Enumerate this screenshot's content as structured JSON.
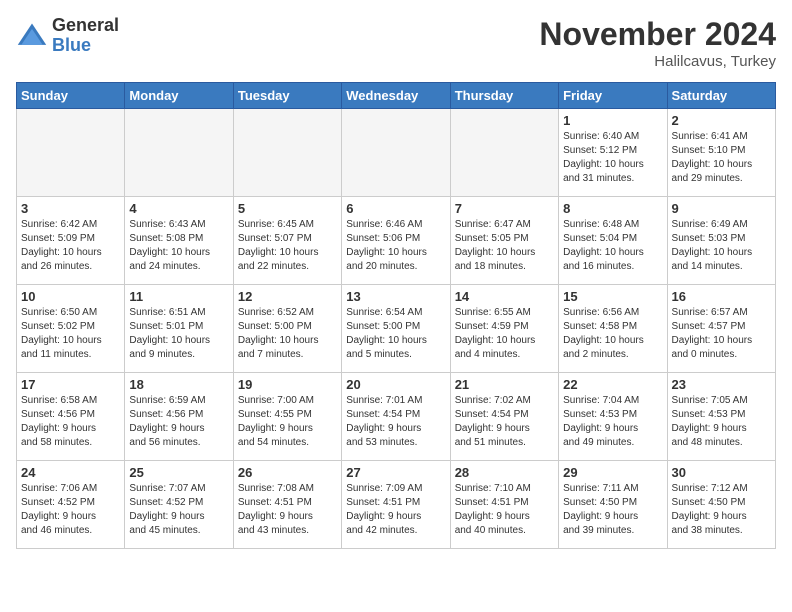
{
  "header": {
    "logo_general": "General",
    "logo_blue": "Blue",
    "month_title": "November 2024",
    "location": "Halilcavus, Turkey"
  },
  "weekdays": [
    "Sunday",
    "Monday",
    "Tuesday",
    "Wednesday",
    "Thursday",
    "Friday",
    "Saturday"
  ],
  "weeks": [
    [
      {
        "day": "",
        "info": ""
      },
      {
        "day": "",
        "info": ""
      },
      {
        "day": "",
        "info": ""
      },
      {
        "day": "",
        "info": ""
      },
      {
        "day": "",
        "info": ""
      },
      {
        "day": "1",
        "info": "Sunrise: 6:40 AM\nSunset: 5:12 PM\nDaylight: 10 hours\nand 31 minutes."
      },
      {
        "day": "2",
        "info": "Sunrise: 6:41 AM\nSunset: 5:10 PM\nDaylight: 10 hours\nand 29 minutes."
      }
    ],
    [
      {
        "day": "3",
        "info": "Sunrise: 6:42 AM\nSunset: 5:09 PM\nDaylight: 10 hours\nand 26 minutes."
      },
      {
        "day": "4",
        "info": "Sunrise: 6:43 AM\nSunset: 5:08 PM\nDaylight: 10 hours\nand 24 minutes."
      },
      {
        "day": "5",
        "info": "Sunrise: 6:45 AM\nSunset: 5:07 PM\nDaylight: 10 hours\nand 22 minutes."
      },
      {
        "day": "6",
        "info": "Sunrise: 6:46 AM\nSunset: 5:06 PM\nDaylight: 10 hours\nand 20 minutes."
      },
      {
        "day": "7",
        "info": "Sunrise: 6:47 AM\nSunset: 5:05 PM\nDaylight: 10 hours\nand 18 minutes."
      },
      {
        "day": "8",
        "info": "Sunrise: 6:48 AM\nSunset: 5:04 PM\nDaylight: 10 hours\nand 16 minutes."
      },
      {
        "day": "9",
        "info": "Sunrise: 6:49 AM\nSunset: 5:03 PM\nDaylight: 10 hours\nand 14 minutes."
      }
    ],
    [
      {
        "day": "10",
        "info": "Sunrise: 6:50 AM\nSunset: 5:02 PM\nDaylight: 10 hours\nand 11 minutes."
      },
      {
        "day": "11",
        "info": "Sunrise: 6:51 AM\nSunset: 5:01 PM\nDaylight: 10 hours\nand 9 minutes."
      },
      {
        "day": "12",
        "info": "Sunrise: 6:52 AM\nSunset: 5:00 PM\nDaylight: 10 hours\nand 7 minutes."
      },
      {
        "day": "13",
        "info": "Sunrise: 6:54 AM\nSunset: 5:00 PM\nDaylight: 10 hours\nand 5 minutes."
      },
      {
        "day": "14",
        "info": "Sunrise: 6:55 AM\nSunset: 4:59 PM\nDaylight: 10 hours\nand 4 minutes."
      },
      {
        "day": "15",
        "info": "Sunrise: 6:56 AM\nSunset: 4:58 PM\nDaylight: 10 hours\nand 2 minutes."
      },
      {
        "day": "16",
        "info": "Sunrise: 6:57 AM\nSunset: 4:57 PM\nDaylight: 10 hours\nand 0 minutes."
      }
    ],
    [
      {
        "day": "17",
        "info": "Sunrise: 6:58 AM\nSunset: 4:56 PM\nDaylight: 9 hours\nand 58 minutes."
      },
      {
        "day": "18",
        "info": "Sunrise: 6:59 AM\nSunset: 4:56 PM\nDaylight: 9 hours\nand 56 minutes."
      },
      {
        "day": "19",
        "info": "Sunrise: 7:00 AM\nSunset: 4:55 PM\nDaylight: 9 hours\nand 54 minutes."
      },
      {
        "day": "20",
        "info": "Sunrise: 7:01 AM\nSunset: 4:54 PM\nDaylight: 9 hours\nand 53 minutes."
      },
      {
        "day": "21",
        "info": "Sunrise: 7:02 AM\nSunset: 4:54 PM\nDaylight: 9 hours\nand 51 minutes."
      },
      {
        "day": "22",
        "info": "Sunrise: 7:04 AM\nSunset: 4:53 PM\nDaylight: 9 hours\nand 49 minutes."
      },
      {
        "day": "23",
        "info": "Sunrise: 7:05 AM\nSunset: 4:53 PM\nDaylight: 9 hours\nand 48 minutes."
      }
    ],
    [
      {
        "day": "24",
        "info": "Sunrise: 7:06 AM\nSunset: 4:52 PM\nDaylight: 9 hours\nand 46 minutes."
      },
      {
        "day": "25",
        "info": "Sunrise: 7:07 AM\nSunset: 4:52 PM\nDaylight: 9 hours\nand 45 minutes."
      },
      {
        "day": "26",
        "info": "Sunrise: 7:08 AM\nSunset: 4:51 PM\nDaylight: 9 hours\nand 43 minutes."
      },
      {
        "day": "27",
        "info": "Sunrise: 7:09 AM\nSunset: 4:51 PM\nDaylight: 9 hours\nand 42 minutes."
      },
      {
        "day": "28",
        "info": "Sunrise: 7:10 AM\nSunset: 4:51 PM\nDaylight: 9 hours\nand 40 minutes."
      },
      {
        "day": "29",
        "info": "Sunrise: 7:11 AM\nSunset: 4:50 PM\nDaylight: 9 hours\nand 39 minutes."
      },
      {
        "day": "30",
        "info": "Sunrise: 7:12 AM\nSunset: 4:50 PM\nDaylight: 9 hours\nand 38 minutes."
      }
    ]
  ]
}
